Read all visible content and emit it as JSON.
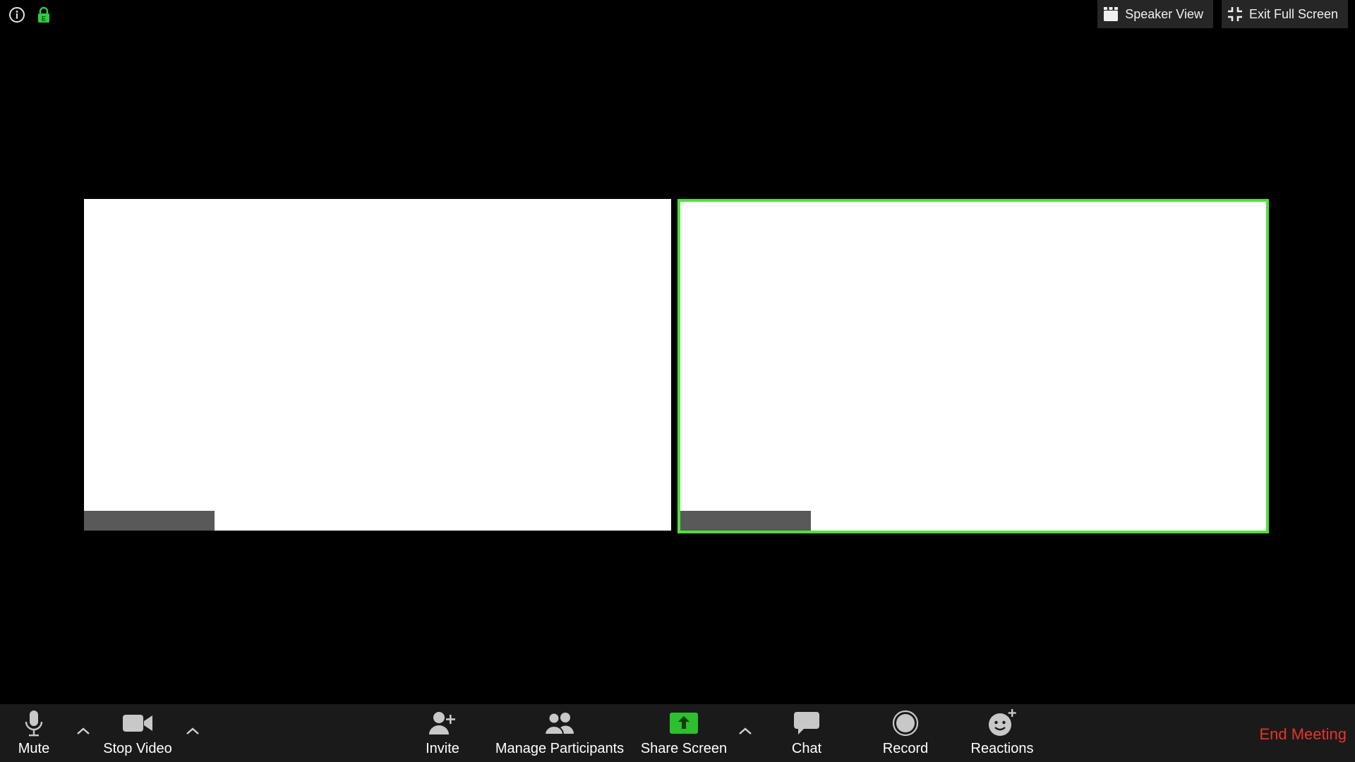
{
  "top_bar": {
    "speaker_view_label": "Speaker View",
    "exit_full_screen_label": "Exit Full Screen",
    "icons": [
      "info-icon",
      "encryption-lock-icon",
      "speaker-view-grid-icon",
      "exit-full-screen-icon"
    ]
  },
  "video_tiles": [
    {
      "name": "",
      "active_speaker": false
    },
    {
      "name": "",
      "active_speaker": true
    }
  ],
  "colors": {
    "background": "#000000",
    "toolbar": "#1a1a1a",
    "active_speaker_border": "#4fe23a",
    "share_screen_button": "#2dbf2d",
    "end_meeting_text": "#e8332b",
    "encryption_icon": "#2ecc40"
  },
  "toolbar": {
    "mute_label": "Mute",
    "stop_video_label": "Stop Video",
    "invite_label": "Invite",
    "manage_participants_label": "Manage Participants",
    "share_screen_label": "Share Screen",
    "chat_label": "Chat",
    "record_label": "Record",
    "reactions_label": "Reactions",
    "end_meeting_label": "End Meeting"
  }
}
